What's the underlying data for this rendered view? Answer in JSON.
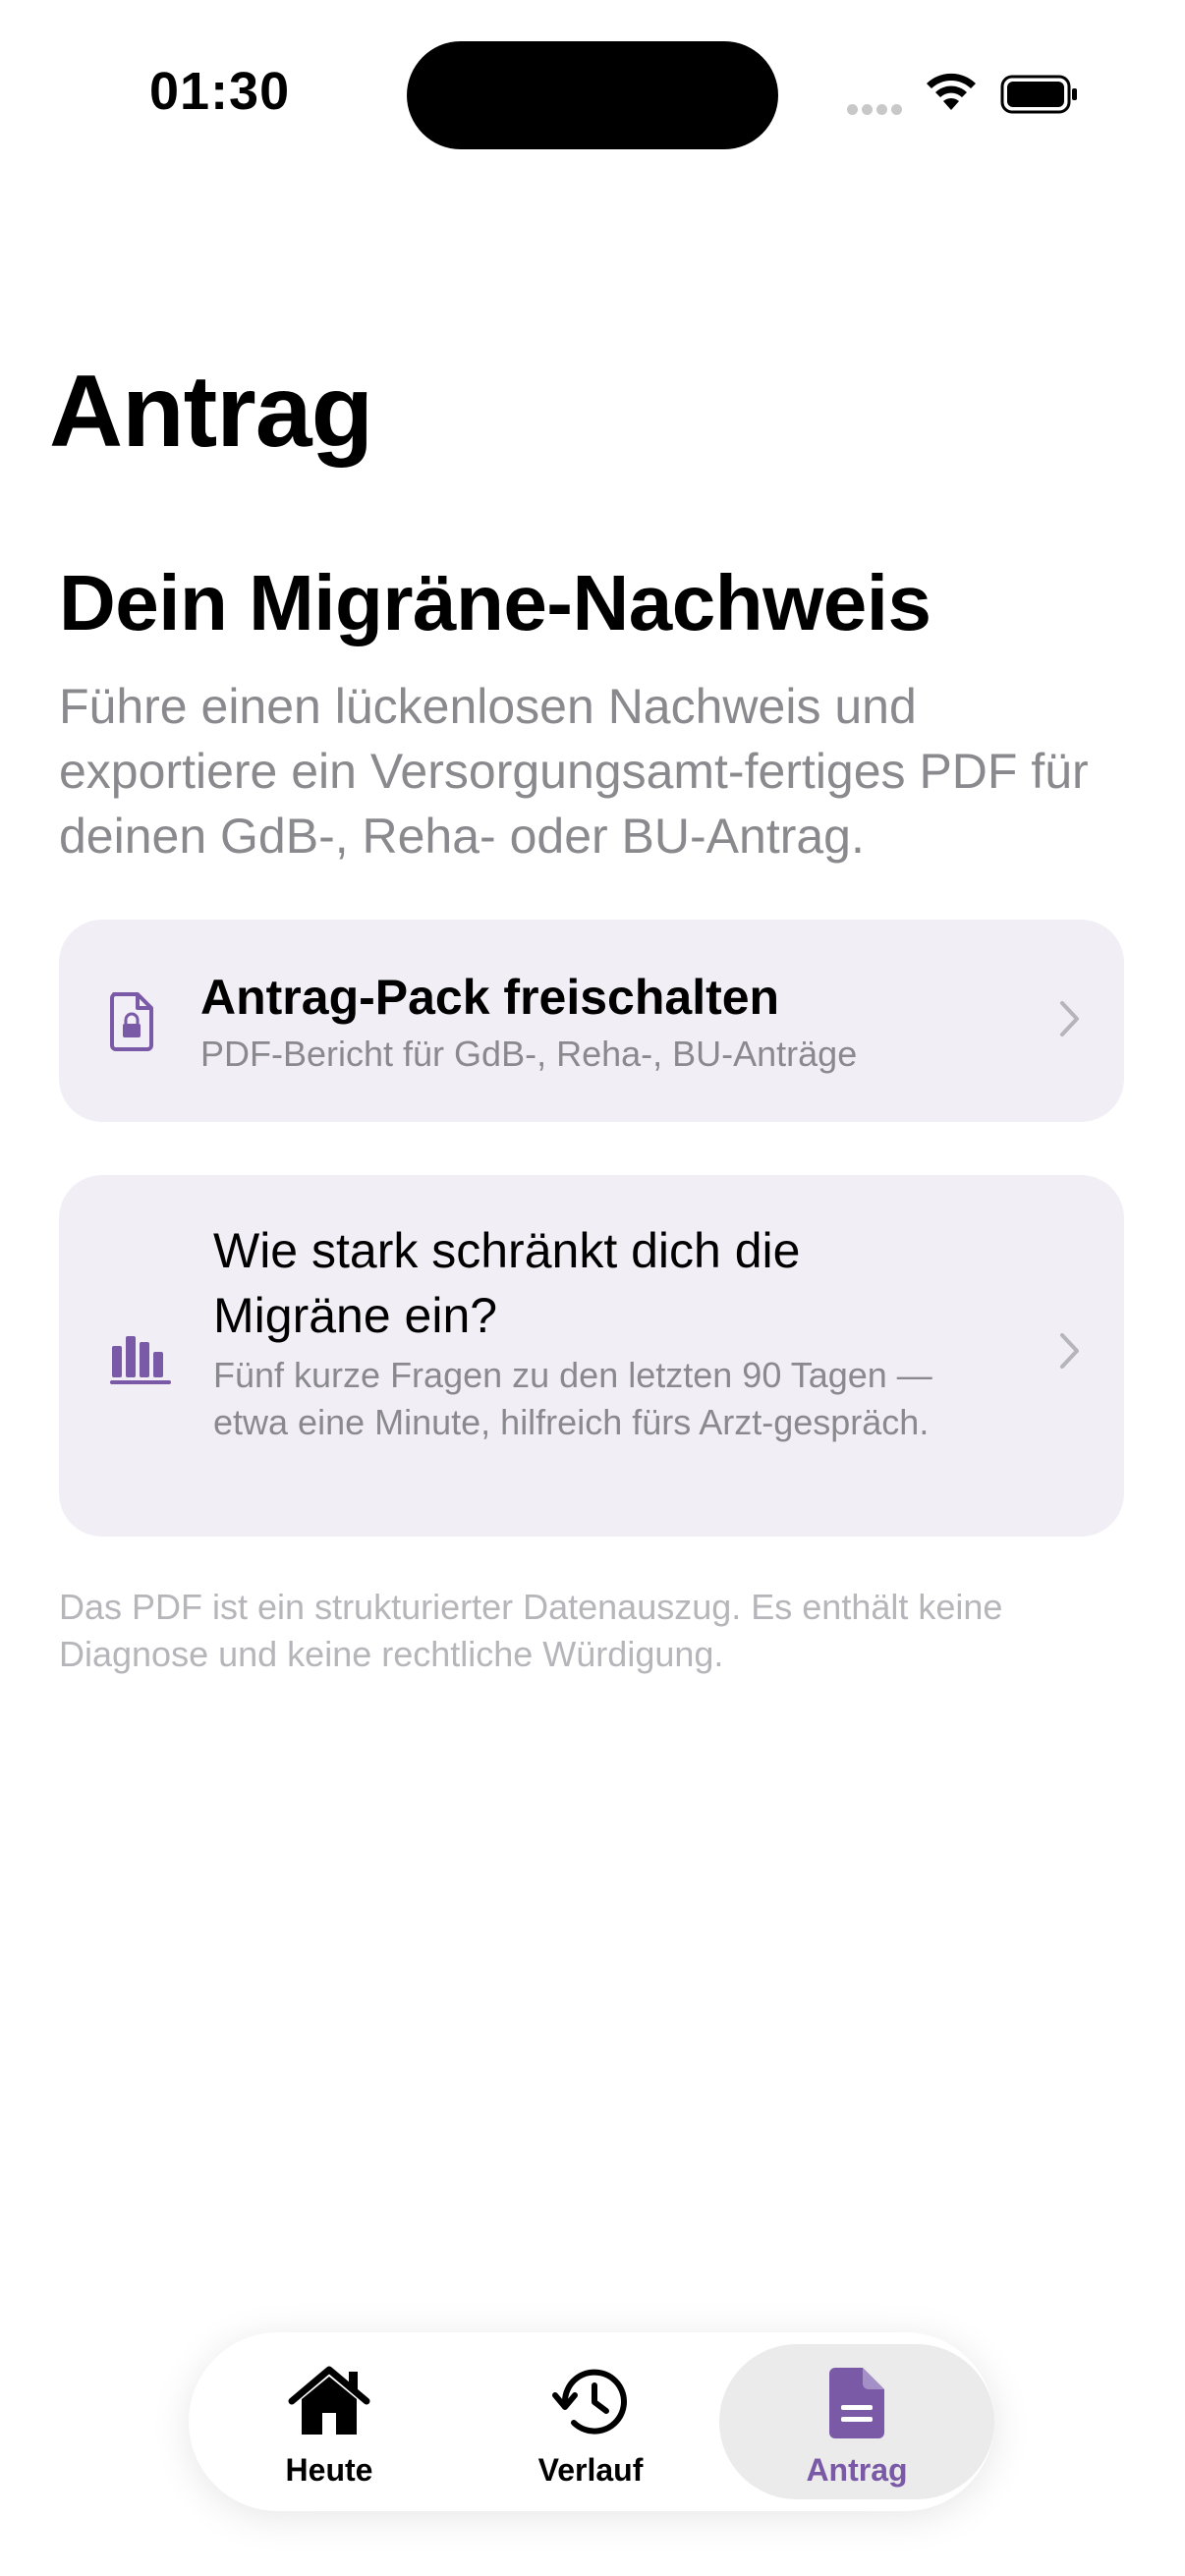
{
  "status_bar": {
    "time": "01:30"
  },
  "nav": {
    "title": "Antrag"
  },
  "section": {
    "heading": "Dein Migräne-Nachweis",
    "description": "Führe einen lückenlosen Nachweis und exportiere ein Versorgungsamt-fertiges PDF für deinen GdB-, Reha- oder BU-Antrag."
  },
  "cards": [
    {
      "icon": "locked-document-icon",
      "title": "Antrag-Pack freischalten",
      "subtitle": "PDF-Bericht für GdB-, Reha-, BU-Anträge"
    },
    {
      "icon": "bar-chart-icon",
      "title": "Wie stark schränkt dich die Migräne ein?",
      "subtitle": "Fünf kurze Fragen zu den letzten 90 Tagen — etwa eine Minute, hilfreich fürs Arzt-gespräch."
    }
  ],
  "disclaimer": "Das PDF ist ein strukturierter Datenauszug. Es enthält keine Diagnose und keine rechtliche Würdigung.",
  "tabbar": {
    "active": "Antrag",
    "items": [
      {
        "label": "Heute",
        "icon": "house-icon"
      },
      {
        "label": "Verlauf",
        "icon": "history-icon"
      },
      {
        "label": "Antrag",
        "icon": "document-icon"
      }
    ]
  },
  "colors": {
    "accent": "#7a59a6",
    "card_bg": "#f1eff5",
    "secondary_text": "#8a8a8e"
  }
}
